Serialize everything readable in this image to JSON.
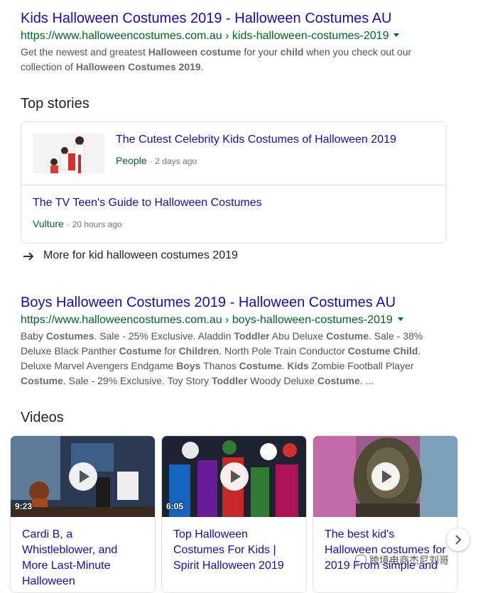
{
  "result1": {
    "title": "Kids Halloween Costumes 2019 - Halloween Costumes AU",
    "url": "https://www.halloweencostumes.com.au › kids-halloween-costumes-2019",
    "snippet_html": "Get the newest and greatest <b>Halloween costume</b> for your <b>child</b> when you check out our collection of <b>Halloween Costumes 2019</b>."
  },
  "top_stories": {
    "heading": "Top stories",
    "items": [
      {
        "title": "The Cutest Celebrity Kids Costumes of Halloween 2019",
        "source": "People",
        "time": "2 days ago"
      },
      {
        "title": "The TV Teen's Guide to Halloween Costumes",
        "source": "Vulture",
        "time": "20 hours ago"
      }
    ],
    "more_label": "More for kid halloween costumes 2019"
  },
  "result2": {
    "title": "Boys Halloween Costumes 2019 - Halloween Costumes AU",
    "url": "https://www.halloweencostumes.com.au › boys-halloween-costumes-2019",
    "snippet_html": "Baby <b>Costumes</b>. Sale - 25% Exclusive. Aladdin <b>Toddler</b> Abu Deluxe <b>Costume</b>. Sale - 38% Deluxe Black Panther <b>Costume</b> for <b>Children</b>. North Pole Train Conductor <b>Costume Child</b>. Deluxe Marvel Avengers Endgame <b>Boys</b> Thanos <b>Costume</b>. <b>Kids</b> Zombie Football Player <b>Costume</b>. Sale - 29% Exclusive. Toy Story <b>Toddler</b> Woody Deluxe <b>Costume</b>. ..."
  },
  "videos": {
    "heading": "Videos",
    "items": [
      {
        "title": "Cardi B, a Whistleblower, and More Last-Minute Halloween",
        "duration": "9:23"
      },
      {
        "title": "Top Halloween Costumes For Kids | Spirit Halloween 2019",
        "duration": "6:05"
      },
      {
        "title": "The best kid's Halloween costumes for 2019 From simple and",
        "duration": ""
      }
    ]
  },
  "watermark": "跨境电商杰尼刘哥",
  "colors": {
    "link": "#1a0dab",
    "url": "#006621",
    "snippet": "#545454",
    "border": "#dfe1e5"
  }
}
